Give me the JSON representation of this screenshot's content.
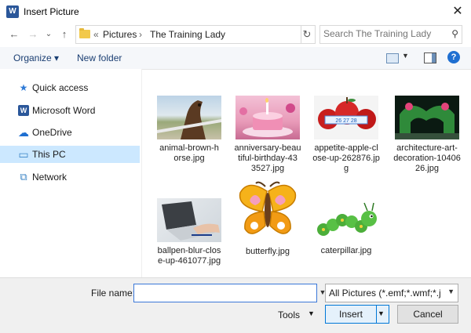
{
  "window": {
    "title": "Insert Picture",
    "app_icon": "W"
  },
  "nav": {
    "back_icon": "←",
    "forward_icon": "→",
    "recent_icon": "⌄",
    "up_icon": "↑",
    "crumbs": [
      "«",
      "Pictures",
      "›",
      "The Training Lady"
    ],
    "refresh_icon": "↻",
    "search_placeholder": "Search The Training Lady"
  },
  "toolbar": {
    "organize": "Organize ▾",
    "new_folder": "New folder",
    "help": "?"
  },
  "sidebar": {
    "items": [
      {
        "label": "Quick access",
        "icon": "★",
        "color": "#2f7ad6"
      },
      {
        "label": "Microsoft Word",
        "icon": "W",
        "color": "#2b579a"
      },
      {
        "label": "OneDrive",
        "icon": "☁",
        "color": "#1f6fd1"
      },
      {
        "label": "This PC",
        "icon": "▭",
        "color": "#3d86c6"
      },
      {
        "label": "Network",
        "icon": "⧉",
        "color": "#3d86c6"
      }
    ],
    "selected": "This PC"
  },
  "files": [
    {
      "name": "animal-brown-horse.jpg",
      "lines": [
        "animal-brown-h",
        "orse.jpg"
      ]
    },
    {
      "name": "anniversary-beautiful-birthday-43527.jpg",
      "lines": [
        "anniversary-beau",
        "tiful-birthday-43",
        "3527.jpg"
      ]
    },
    {
      "name": "appetite-apple-close-up-262876.jpg",
      "lines": [
        "appetite-apple-cl",
        "ose-up-262876.jp",
        "g"
      ],
      "thumb_text": "26  27  28"
    },
    {
      "name": "architecture-art-decoration-1040626.jpg",
      "lines": [
        "architecture-art-",
        "decoration-10406",
        "26.jpg"
      ]
    },
    {
      "name": "ballpen-blur-close-up-461077.jpg",
      "lines": [
        "ballpen-blur-clos",
        "e-up-461077.jpg"
      ]
    },
    {
      "name": "butterfly.jpg",
      "lines": [
        "butterfly.jpg"
      ]
    },
    {
      "name": "caterpillar.jpg",
      "lines": [
        "caterpillar.jpg"
      ]
    }
  ],
  "footer": {
    "file_name_label": "File name:",
    "file_name_value": "",
    "filter": "All Pictures (*.emf;*.wmf;*.jpg;*",
    "tools": "Tools",
    "insert": "Insert",
    "cancel": "Cancel"
  }
}
